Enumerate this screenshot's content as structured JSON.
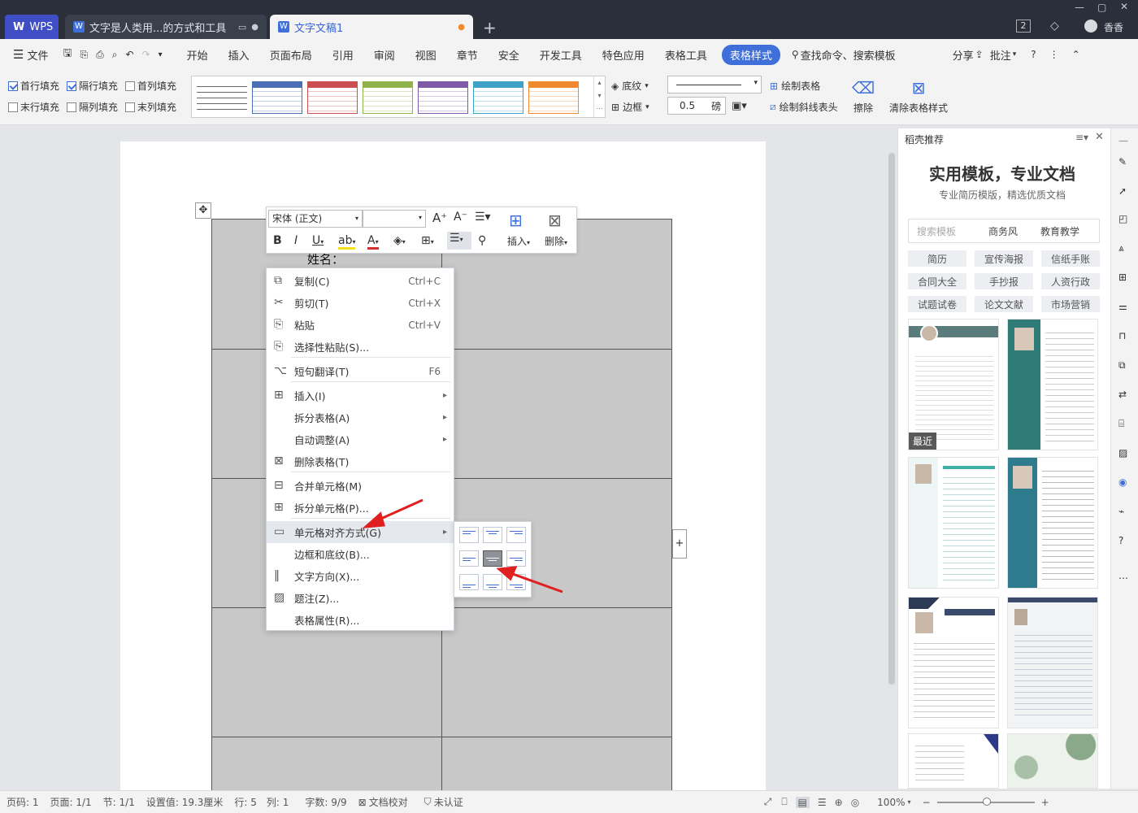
{
  "titlebar": {
    "app_name": "WPS",
    "tab1": "文字是人类用...的方式和工具",
    "tab2": "文字文稿1",
    "page_count_badge": "2",
    "user": "香香"
  },
  "menubar": {
    "file": "文件",
    "items": [
      "开始",
      "插入",
      "页面布局",
      "引用",
      "审阅",
      "视图",
      "章节",
      "安全",
      "开发工具",
      "特色应用",
      "表格工具",
      "表格样式"
    ],
    "active": "表格样式",
    "search": "查找命令、搜索模板",
    "share": "分享",
    "annotate": "批注"
  },
  "ribbon": {
    "checks": [
      {
        "label": "首行填充",
        "checked": true
      },
      {
        "label": "隔行填充",
        "checked": true
      },
      {
        "label": "首列填充",
        "checked": false
      },
      {
        "label": "末行填充",
        "checked": false
      },
      {
        "label": "隔列填充",
        "checked": false
      },
      {
        "label": "末列填充",
        "checked": false
      }
    ],
    "style_colors": [
      "#4a6fb5",
      "#c9504f",
      "#8fb24a",
      "#7f5aa8",
      "#3fa3c8",
      "#f08a2e"
    ],
    "shading": "底纹",
    "border": "边框",
    "line_width": "0.5",
    "line_unit": "磅",
    "draw_table": "绘制表格",
    "draw_diag": "绘制斜线表头",
    "erase": "擦除",
    "clear_style": "清除表格样式"
  },
  "document": {
    "cell_text": "姓名："
  },
  "minibar": {
    "font": "宋体 (正文)",
    "size": "",
    "insert": "插入",
    "delete": "删除"
  },
  "context_menu": {
    "items": [
      {
        "label": "复制(C)",
        "shortcut": "Ctrl+C"
      },
      {
        "label": "剪切(T)",
        "shortcut": "Ctrl+X"
      },
      {
        "label": "粘贴",
        "shortcut": "Ctrl+V"
      },
      {
        "label": "选择性粘贴(S)...",
        "shortcut": ""
      },
      {
        "label": "短句翻译(T)",
        "shortcut": "F6"
      },
      {
        "label": "插入(I)",
        "shortcut": ""
      },
      {
        "label": "拆分表格(A)",
        "shortcut": ""
      },
      {
        "label": "自动调整(A)",
        "shortcut": ""
      },
      {
        "label": "删除表格(T)",
        "shortcut": ""
      },
      {
        "label": "合并单元格(M)",
        "shortcut": ""
      },
      {
        "label": "拆分单元格(P)...",
        "shortcut": ""
      },
      {
        "label": "单元格对齐方式(G)",
        "shortcut": ""
      },
      {
        "label": "边框和底纹(B)...",
        "shortcut": ""
      },
      {
        "label": "文字方向(X)...",
        "shortcut": ""
      },
      {
        "label": "题注(Z)...",
        "shortcut": ""
      },
      {
        "label": "表格属性(R)...",
        "shortcut": ""
      }
    ],
    "highlighted": "单元格对齐方式(G)"
  },
  "right_panel": {
    "header": "稻壳推荐",
    "title": "实用模板，专业文档",
    "subtitle": "专业简历模版，精选优质文档",
    "search_placeholder": "搜索模板",
    "search_tabs": [
      "商务风",
      "教育教学"
    ],
    "tags": [
      "简历",
      "宣传海报",
      "信纸手账",
      "合同大全",
      "手抄报",
      "人资行政",
      "试题试卷",
      "论文文献",
      "市场营销"
    ],
    "recent_badge": "最近"
  },
  "statusbar": {
    "page_num": "页码: 1",
    "pages": "页面: 1/1",
    "section": "节: 1/1",
    "setting": "设置值: 19.3厘米",
    "row": "行: 5",
    "col": "列: 1",
    "words": "字数: 9/9",
    "proof": "文档校对",
    "cert": "未认证",
    "zoom": "100%"
  }
}
